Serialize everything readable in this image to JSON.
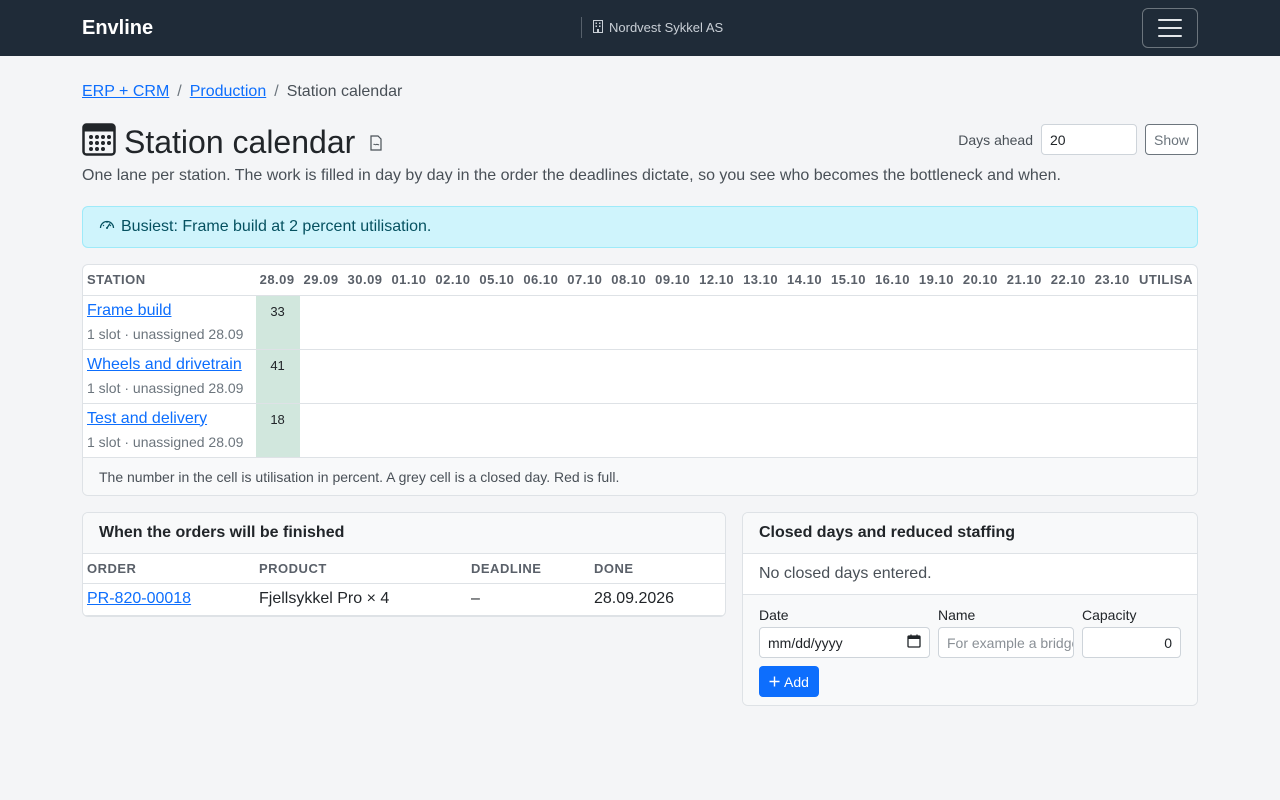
{
  "nav": {
    "brand": "Envline",
    "company": "Nordvest Sykkel AS"
  },
  "breadcrumb": {
    "items": [
      "ERP + CRM",
      "Production"
    ],
    "separator": "/",
    "current": "Station calendar"
  },
  "page": {
    "title": "Station calendar",
    "lead": "One lane per station. The work is filled in day by day in the order the deadlines dictate, so you see who becomes the bottleneck and when."
  },
  "days_form": {
    "label": "Days ahead",
    "value": "20",
    "button": "Show"
  },
  "alert": {
    "text": "Busiest: Frame build at 2 percent utilisation."
  },
  "calendar": {
    "station_header": "STATION",
    "dates": [
      "28.09",
      "29.09",
      "30.09",
      "01.10",
      "02.10",
      "05.10",
      "06.10",
      "07.10",
      "08.10",
      "09.10",
      "12.10",
      "13.10",
      "14.10",
      "15.10",
      "16.10",
      "19.10",
      "20.10",
      "21.10",
      "22.10",
      "23.10"
    ],
    "util_header": "UTILISA",
    "stations": [
      {
        "name": "Frame build",
        "meta": "1 slot · unassigned 28.09",
        "util": "33"
      },
      {
        "name": "Wheels and drivetrain",
        "meta": "1 slot · unassigned 28.09",
        "util": "41"
      },
      {
        "name": "Test and delivery",
        "meta": "1 slot · unassigned 28.09",
        "util": "18"
      }
    ],
    "footer": "The number in the cell is utilisation in percent. A grey cell is a closed day. Red is full."
  },
  "orders": {
    "title": "When the orders will be finished",
    "headers": [
      "ORDER",
      "PRODUCT",
      "DEADLINE",
      "DONE"
    ],
    "rows": [
      {
        "order": "PR-820-00018",
        "product": "Fjellsykkel Pro × 4",
        "deadline": "–",
        "done": "28.09.2026"
      }
    ]
  },
  "closed": {
    "title": "Closed days and reduced staffing",
    "empty": "No closed days entered.",
    "date_label": "Date",
    "date_placeholder": "mm/dd/yyyy",
    "name_label": "Name",
    "name_placeholder": "For example a bridge day",
    "capacity_label": "Capacity",
    "capacity_value": "0",
    "add_button": "Add"
  },
  "colors": {
    "navbar": "#1f2b38",
    "link": "#0d6efd",
    "util_cell": "#d1e7dd",
    "alert_bg": "#cff4fc",
    "primary": "#0d6efd"
  }
}
